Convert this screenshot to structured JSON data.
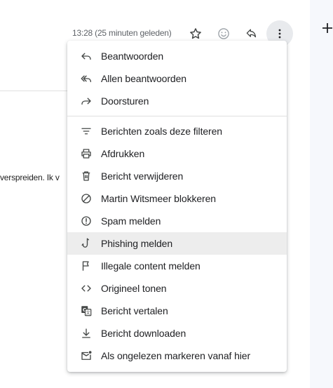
{
  "header": {
    "timestamp": "13:28 (25 minuten geleden)",
    "icons": [
      "star-icon",
      "emoji-icon",
      "reply-icon",
      "more-vert-icon"
    ]
  },
  "body_snippet": "verspreiden. Ik v",
  "side_panel": {
    "icon": "plus-icon"
  },
  "menu": {
    "group1": [
      {
        "label": "Beantwoorden",
        "icon": "reply-icon"
      },
      {
        "label": "Allen beantwoorden",
        "icon": "reply-all-icon"
      },
      {
        "label": "Doorsturen",
        "icon": "forward-icon"
      }
    ],
    "group2": [
      {
        "label": "Berichten zoals deze filteren",
        "icon": "filter-icon"
      },
      {
        "label": "Afdrukken",
        "icon": "print-icon"
      },
      {
        "label": "Bericht verwijderen",
        "icon": "trash-icon"
      },
      {
        "label": "Martin Witsmeer blokkeren",
        "icon": "block-icon"
      },
      {
        "label": "Spam melden",
        "icon": "report-icon"
      },
      {
        "label": "Phishing melden",
        "icon": "phishing-hook-icon",
        "highlighted": true
      },
      {
        "label": "Illegale content melden",
        "icon": "flag-icon"
      },
      {
        "label": "Origineel tonen",
        "icon": "code-icon"
      },
      {
        "label": "Bericht vertalen",
        "icon": "translate-icon"
      },
      {
        "label": "Bericht downloaden",
        "icon": "download-icon"
      },
      {
        "label": "Als ongelezen markeren vanaf hier",
        "icon": "mark-unread-icon"
      }
    ]
  },
  "colors": {
    "icon": "#444746",
    "text": "#202124",
    "highlight": "#ededed",
    "more_button_bg": "#e8eaed"
  }
}
